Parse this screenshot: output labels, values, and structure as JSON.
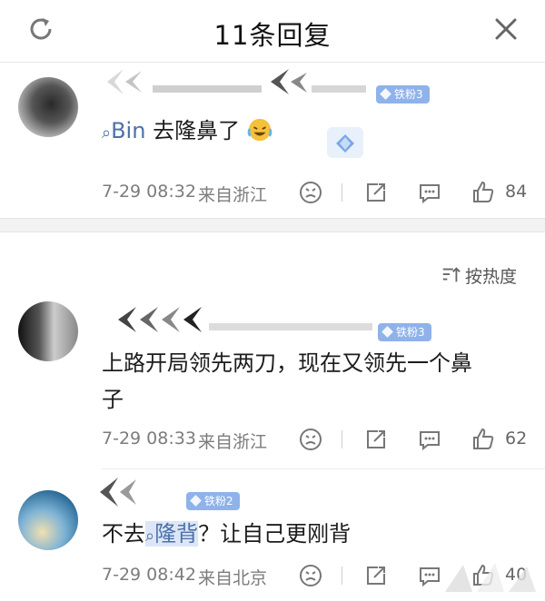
{
  "header": {
    "title": "11条回复",
    "refresh_icon": "refresh-icon",
    "close_icon": "close-icon"
  },
  "sort": {
    "label": "按热度",
    "icon": "sort-icon"
  },
  "colors": {
    "link": "#4c71a8",
    "badge": "#8fb2ea",
    "meta": "#7c7c7c",
    "band": "#f2f2f2"
  },
  "comments": [
    {
      "badge": "铁粉3",
      "link_text": "Bin",
      "text": "去隆鼻了",
      "emoji": "laughing-crying-emoji",
      "time": "7-29 08:32",
      "source": "来自浙江",
      "likes": "84"
    },
    {
      "badge": "铁粉3",
      "text_line1": "上路开局领先两刀，现在又领先一个鼻",
      "text_line2": "子",
      "time": "7-29 08:33",
      "source": "来自浙江",
      "likes": "62"
    },
    {
      "badge": "铁粉2",
      "text_prefix": "不去",
      "link_text": "隆背",
      "text_suffix": "？让自己更刚背",
      "time": "7-29 08:42",
      "source": "来自北京",
      "likes": "40"
    }
  ]
}
